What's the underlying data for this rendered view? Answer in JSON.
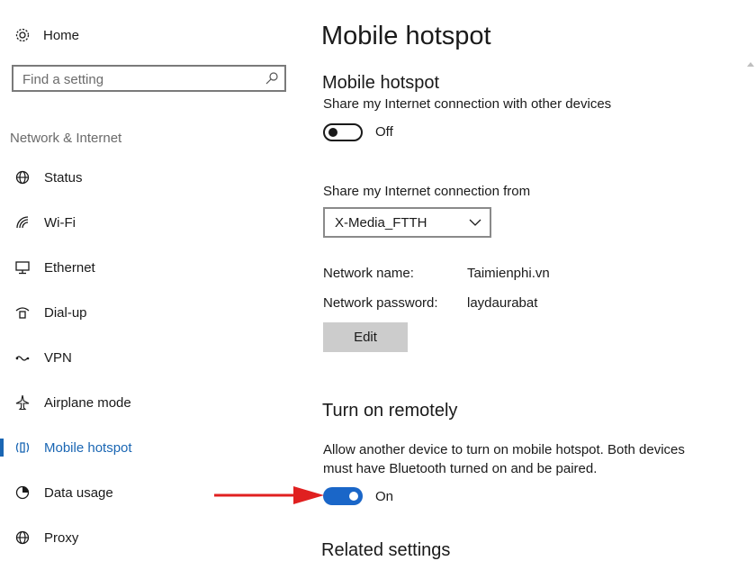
{
  "sidebar": {
    "home_label": "Home",
    "search_placeholder": "Find a setting",
    "section_label": "Network & Internet",
    "items": [
      {
        "label": "Status",
        "icon": "globe-status-icon"
      },
      {
        "label": "Wi-Fi",
        "icon": "wifi-icon"
      },
      {
        "label": "Ethernet",
        "icon": "ethernet-icon"
      },
      {
        "label": "Dial-up",
        "icon": "dial-up-icon"
      },
      {
        "label": "VPN",
        "icon": "vpn-icon"
      },
      {
        "label": "Airplane mode",
        "icon": "airplane-icon"
      },
      {
        "label": "Mobile hotspot",
        "icon": "mobile-hotspot-icon",
        "active": true
      },
      {
        "label": "Data usage",
        "icon": "data-usage-icon"
      },
      {
        "label": "Proxy",
        "icon": "proxy-globe-icon"
      }
    ]
  },
  "main": {
    "page_title": "Mobile hotspot",
    "hotspot": {
      "title": "Mobile hotspot",
      "description": "Share my Internet connection with other devices",
      "toggle_state": "Off"
    },
    "share_from": {
      "label": "Share my Internet connection from",
      "selected": "X-Media_FTTH"
    },
    "network_name_label": "Network name:",
    "network_name_value": "Taimienphi.vn",
    "network_password_label": "Network password:",
    "network_password_value": "laydaurabat",
    "edit_button": "Edit",
    "remote": {
      "title": "Turn on remotely",
      "description_line1": "Allow another device to turn on mobile hotspot. Both devices",
      "description_line2": "must have Bluetooth turned on and be paired.",
      "toggle_state": "On"
    },
    "related_heading_partial": "Related settings"
  },
  "colors": {
    "accent": "#1a66b3",
    "toggle_on": "#1a66c8",
    "arrow": "#e02020",
    "button_bg": "#cccccc"
  }
}
